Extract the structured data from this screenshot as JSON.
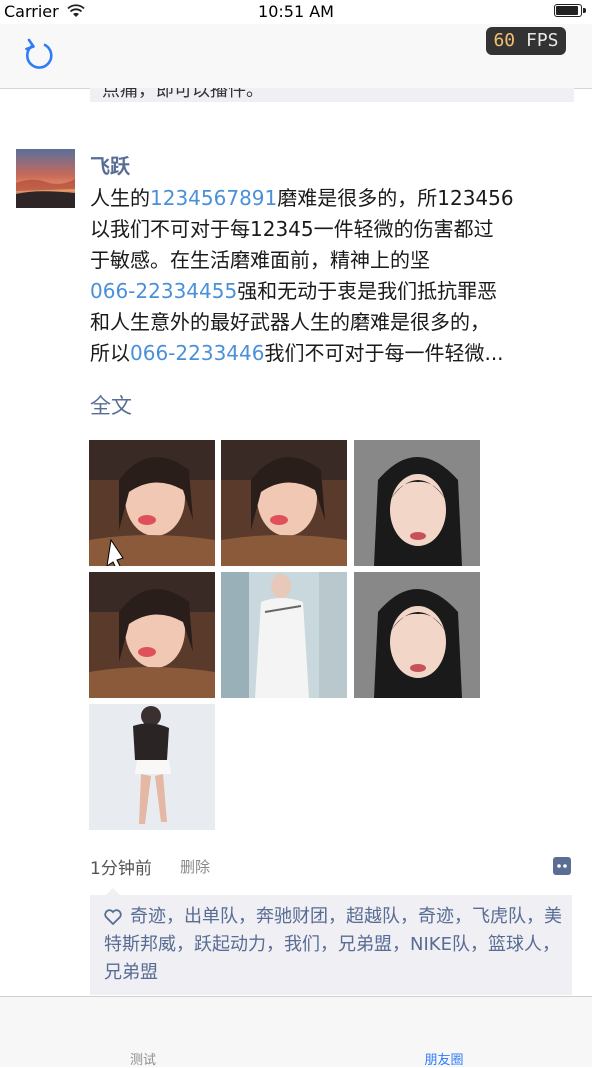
{
  "status_bar": {
    "carrier": "Carrier",
    "time": "10:51 AM"
  },
  "nav": {
    "fps_value": "60",
    "fps_unit": "FPS"
  },
  "previous_post": {
    "text": "点痛，即可以播件。"
  },
  "post": {
    "username": "飞跃",
    "lines": [
      [
        {
          "t": "人生的",
          "link": false
        },
        {
          "t": "1234567891",
          "link": true
        },
        {
          "t": "磨难是很多的，所123456",
          "link": false
        }
      ],
      [
        {
          "t": "以我们不可对于每12345一件轻微的伤害都过",
          "link": false
        }
      ],
      [
        {
          "t": "于敏感。在生活磨难面前，精神上的坚",
          "link": false
        }
      ],
      [
        {
          "t": "066-22334455",
          "link": true
        },
        {
          "t": "强和无动于衷是我们抵抗罪恶",
          "link": false
        }
      ],
      [
        {
          "t": "和人生意外的最好武器人生的磨难是很多的，",
          "link": false
        }
      ],
      [
        {
          "t": "所以",
          "link": false
        },
        {
          "t": "066-2233446",
          "link": true
        },
        {
          "t": "我们不可对于每一件轻微...",
          "link": false
        }
      ]
    ],
    "full_text_label": "全文",
    "photos": [
      "selfie-1",
      "selfie-2",
      "portrait-1",
      "selfie-3",
      "dress-photo",
      "portrait-2",
      "fashion-photo"
    ],
    "time": "1分钟前",
    "delete_label": "删除",
    "likes": "奇迹，出单队，奔驰财团，超越队，奇迹，飞虎队，美特斯邦威，跃起动力，我们，兄弟盟，NIKE队，篮球人，兄弟盟"
  },
  "tabs": [
    {
      "label": "测试",
      "active": false
    },
    {
      "label": "朋友圈",
      "active": true
    }
  ],
  "colors": {
    "link": "#4a90d9",
    "name": "#586c94",
    "active_tab": "#2f7cf6",
    "likes_bg": "#efeff4"
  }
}
